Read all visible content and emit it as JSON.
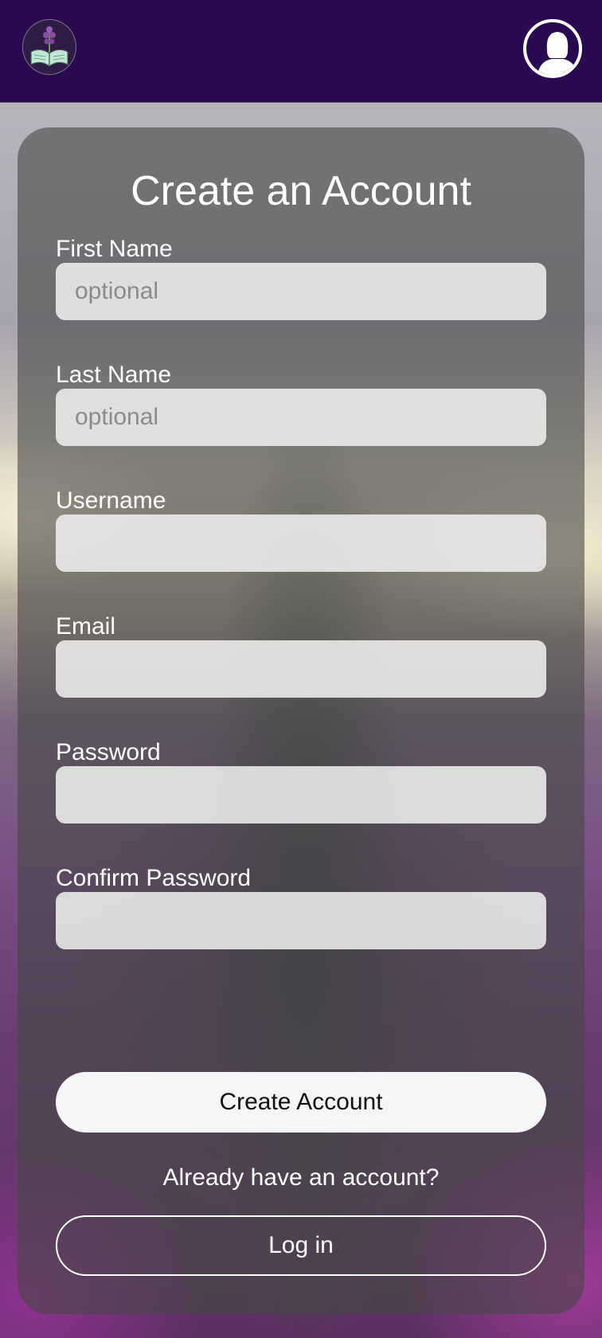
{
  "header": {
    "logo_icon": "book-flower-logo-icon",
    "profile_icon": "user-avatar-icon"
  },
  "form": {
    "title": "Create an Account",
    "fields": [
      {
        "label": "First Name",
        "placeholder": "optional",
        "value": ""
      },
      {
        "label": "Last Name",
        "placeholder": "optional",
        "value": ""
      },
      {
        "label": "Username",
        "placeholder": "",
        "value": ""
      },
      {
        "label": "Email",
        "placeholder": "",
        "value": ""
      },
      {
        "label": "Password",
        "placeholder": "",
        "value": ""
      },
      {
        "label": "Confirm Password",
        "placeholder": "",
        "value": ""
      }
    ],
    "submit_label": "Create Account",
    "login_prompt": "Already have an account?",
    "login_label": "Log in"
  },
  "colors": {
    "header_bg": "#2a0a4e",
    "card_bg": "rgba(70,72,70,0.60)",
    "field_bg": "#eeeeee",
    "text": "#ffffff"
  }
}
